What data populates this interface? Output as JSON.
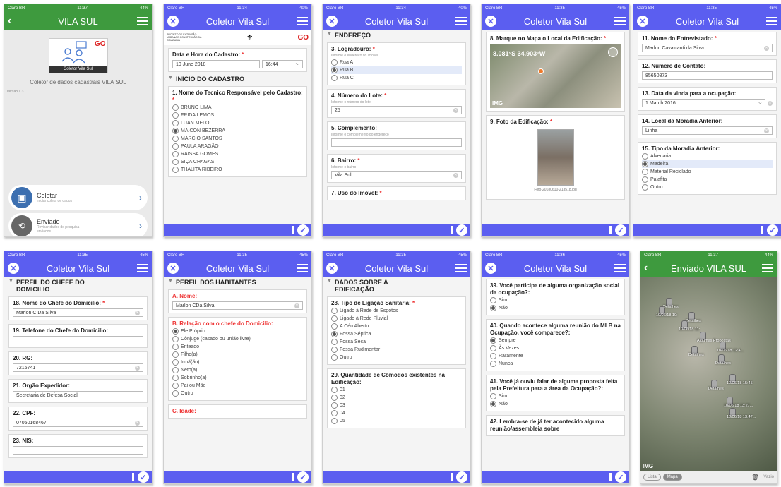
{
  "status": {
    "carrier": "Claro BR",
    "s1": {
      "time": "11:37",
      "battery": "44%"
    },
    "s2": {
      "time": "11:34",
      "battery": "40%"
    },
    "s3": {
      "time": "11:34",
      "battery": "40%"
    },
    "s4": {
      "time": "11:35",
      "battery": "45%"
    },
    "s5": {
      "time": "11:35",
      "battery": "45%"
    },
    "s6": {
      "time": "11:35",
      "battery": "45%"
    },
    "s7": {
      "time": "11:35",
      "battery": "45%"
    },
    "s8": {
      "time": "11:35",
      "battery": "45%"
    },
    "s9": {
      "time": "11:36",
      "battery": "45%"
    },
    "s10": {
      "time": "11:37",
      "battery": "44%"
    }
  },
  "colors": {
    "header_purple": "#5b5ef0",
    "header_green": "#3e9a3e",
    "required": "#e33333"
  },
  "screen1": {
    "title": "VILA SUL",
    "logo_caption": "Coletor Vila Sul",
    "logo_badge": "GO",
    "description": "Coletor de dados cadastrais VILA SUL",
    "version": "versão 1.3",
    "coletar_title": "Coletar",
    "coletar_sub": "Iniciar coleta de dados",
    "enviado_title": "Enviado",
    "enviado_sub": "Revisar dados de pesquisa enviados",
    "chevron": "›"
  },
  "screen2": {
    "title": "Coletor Vila Sul",
    "partner_logo_text": "PROJETO DE EXTENSÃO URBANA E CONSTRUÇÃO DA CIDADANIA",
    "date_label": "Data e Hora do Cadastro:",
    "date_value": "10 June 2018",
    "time_value": "16:44",
    "section": "INICIO DO CADASTRO",
    "q1": "1. Nome do Tecnico Responsável pelo Cadastro:",
    "options": [
      "BRUNO LIMA",
      "FRIDA LEMOS",
      "LUAN MELO",
      "MAICON BEZERRA",
      "MARCIO SANTOS",
      "PAULA ARAGÃO",
      "RAISSA GOMES",
      "SIÇA CHAGAS",
      "THALITA RIBEIRO"
    ],
    "selected": 3
  },
  "screen3": {
    "title": "Coletor Vila Sul",
    "section": "ENDEREÇO",
    "q3": "3. Logradouro:",
    "q3_hint": "Informe o endereço do imóvel",
    "q3_opts": [
      "Rua A",
      "Rua B",
      "Rua C"
    ],
    "q3_sel": 1,
    "q4": "4. Número do Lote:",
    "q4_hint": "Informe o número do lote",
    "q4_val": "25",
    "q5": "5. Complemento:",
    "q5_hint": "Informe o complemento do endereço",
    "q6": "6. Bairro:",
    "q6_hint": "Informe o bairro",
    "q6_val": "Vila Sul",
    "q7": "7. Uso do Imóvel:"
  },
  "screen4": {
    "title": "Coletor Vila Sul",
    "q8": "8. Marque no Mapa o Local da Edificação:",
    "coords": "8.081°S 34.903°W",
    "img": "IMG",
    "q9": "9. Foto da Edificação:",
    "photo_name": "Foto-20180610-213518.jpg"
  },
  "screen5": {
    "title": "Coletor Vila Sul",
    "q11": "11. Nome do Entrevistado:",
    "q11_val": "Marlon Cavalcanti da Silva",
    "q12": "12. Número de Contato:",
    "q12_val": "85650873",
    "q13": "13. Data da vinda para a ocupação:",
    "q13_val": "1 March 2016",
    "q14": "14. Local da Moradia Anterior:",
    "q14_val": "Linha",
    "q15": "15. Tipo da Moradia Anterior:",
    "q15_opts": [
      "Alvenaria",
      "Madeira",
      "Material Reciclado",
      "Palafita",
      "Outro"
    ],
    "q15_sel": 1
  },
  "screen6": {
    "title": "Coletor Vila Sul",
    "section": "PERFIL DO CHEFE DO DOMICILIO",
    "q18": "18. Nome do Chefe do Domicilio:",
    "q18_val": "Marlon C Da Silva",
    "q19": "19. Telefone do Chefe do Domicilio:",
    "q20": "20. RG:",
    "q20_val": "7216741",
    "q21": "21. Orgão Expedidor:",
    "q21_val": "Secretaria de Defesa Social",
    "q22": "22. CPF:",
    "q22_val": "07050168467",
    "q23": "23. NIS:"
  },
  "screen7": {
    "title": "Coletor Vila Sul",
    "section": "PERFIL DOS HABITANTES",
    "qa": "A. Nome:",
    "qa_val": "Marlon CDa Silva",
    "qb": "B. Relação com o chefe do Domicilio:",
    "qb_opts": [
      "Ele Próprio",
      "Cônjuge (casado ou união livre)",
      "Enteado",
      "Filho(a)",
      "Irmã(ão)",
      "Neto(a)",
      "Sobrinho(a)",
      "Pai ou Mãe",
      "Outro"
    ],
    "qb_sel": 0,
    "qc": "C. Idade:"
  },
  "screen8": {
    "title": "Coletor Vila Sul",
    "section": "DADOS SOBRE A EDIFICAÇÃO",
    "q28": "28. Tipo de Ligação Sanitária:",
    "q28_opts": [
      "Ligado à Rede de Esgotos",
      "Ligado à Rede Pluvial",
      "A Céu Aberto",
      "Fossa Séptica",
      "Fossa Seca",
      "Fossa Rudimentar",
      "Outro"
    ],
    "q28_sel": 3,
    "q29": "29. Quantidade de Cômodos existentes na Edificação:",
    "q29_opts": [
      "01",
      "02",
      "03",
      "04",
      "05"
    ]
  },
  "screen9": {
    "title": "Coletor Vila Sul",
    "q39": "39. Você participa de alguma organização social da ocupação?:",
    "q39_opts": [
      "Sim",
      "Não"
    ],
    "q39_sel": 1,
    "q40": "40. Quando acontece alguma reunião do MLB na Ocupação, você comparece?:",
    "q40_opts": [
      "Sempre",
      "Às Vezes",
      "Raramente",
      "Nunca"
    ],
    "q40_sel": 0,
    "q41": "41. Você já ouviu falar de alguma proposta feita pela Prefeitura para a área da Ocupação?:",
    "q41_opts": [
      "Sim",
      "Não"
    ],
    "q41_sel": 1,
    "q42": "42. Lembra-se de já ter acontecido alguma reunião/assembleia sobre"
  },
  "screen10": {
    "title": "Enviado VILA SUL",
    "img": "IMG",
    "tab_list": "Lista",
    "tab_map": "Mapa",
    "trash": "Vazio",
    "pins": [
      "Detalhes",
      "10/06/18 10:",
      "Detalhes",
      "10/06/18 11:",
      "Algumas Propostas",
      "Detalhes",
      "10/06/18 12:4...",
      "Detalhes",
      "10/06/18 15:45",
      "Detalhes",
      "10/06/18 13:27...",
      "10/06/18 13:47..."
    ]
  }
}
